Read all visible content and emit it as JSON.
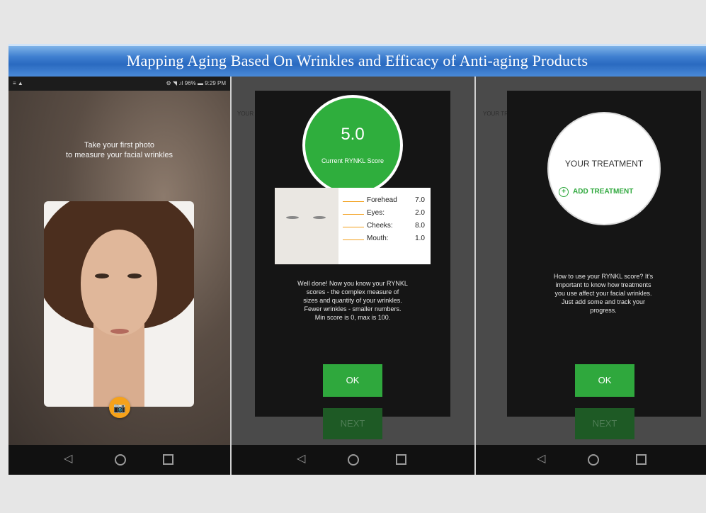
{
  "title": "Mapping Aging Based On Wrinkles and Efficacy of Anti-aging Products",
  "phone1": {
    "status_left": "≡ ▲",
    "status_right": "⚙ ◥ .ıl 96% ▬ 9:29 PM",
    "intro_line1": "Take your first photo",
    "intro_line2": "to measure your facial wrinkles",
    "camera_icon": "camera-icon"
  },
  "phone2": {
    "bg_text_1": "YOUR RYNKL SCORE",
    "score_value": "5.0",
    "score_label": "Current RYNKL Score",
    "breakdown": [
      {
        "label": "Forehead",
        "value": "7.0"
      },
      {
        "label": "Eyes:",
        "value": "2.0"
      },
      {
        "label": "Cheeks:",
        "value": "8.0"
      },
      {
        "label": "Mouth:",
        "value": "1.0"
      }
    ],
    "text_line1": "Well done! Now you know your RYNKL",
    "text_line2": "scores - the complex measure of",
    "text_line3": "sizes and quantity of your wrinkles.",
    "text_line4": "Fewer wrinkles - smaller numbers.",
    "text_line5": "Min score is 0, max is 100.",
    "ok_label": "OK",
    "next_label": "NEXT"
  },
  "phone3": {
    "bg_text_1": "YOUR TREATMENT",
    "treatment_title": "YOUR TREATMENT",
    "add_treatment_label": "ADD TREATMENT",
    "text_line1": "How to use your RYNKL score? It's",
    "text_line2": "important to know how treatments",
    "text_line3": "you use affect your facial wrinkles.",
    "text_line4": "Just add some and track your",
    "text_line5": "progress.",
    "ok_label": "OK",
    "next_label": "NEXT"
  },
  "nav": {
    "back": "◁"
  },
  "colors": {
    "accent_green": "#2fa83d",
    "camera_orange": "#f5a21b",
    "title_blue": "#3f7fd0"
  }
}
